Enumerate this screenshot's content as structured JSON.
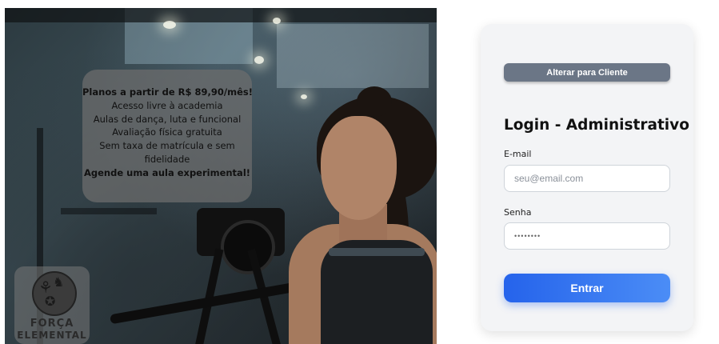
{
  "promo": {
    "lines": [
      "Planos a partir de R$ 89,90/mês!",
      "Acesso livre à academia",
      "Aulas de dança, luta e funcional",
      "Avaliação física gratuita",
      "Sem taxa de matrícula e sem",
      "fidelidade",
      "Agende uma aula experimental!"
    ]
  },
  "logo": {
    "word1": "FORÇA",
    "word2": "ELEMENTAL"
  },
  "login": {
    "switch_label": "Alterar para Cliente",
    "title": "Login - Administrativo",
    "email_label": "E-mail",
    "email_placeholder": "seu@email.com",
    "password_label": "Senha",
    "password_value": "••••••••",
    "submit_label": "Entrar"
  },
  "colors": {
    "primary": "#2563eb",
    "secondary_button": "#6b7686",
    "panel_bg": "#f3f4f6"
  }
}
